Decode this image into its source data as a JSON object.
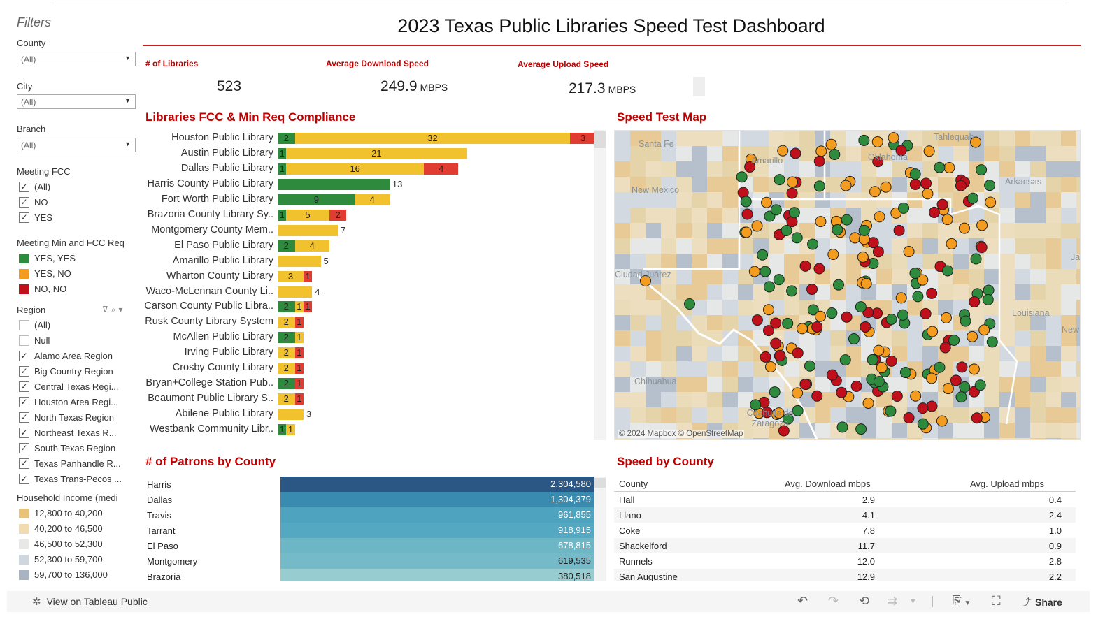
{
  "title": "2023 Texas Public Libraries Speed Test Dashboard",
  "filters": {
    "heading": "Filters",
    "county": {
      "label": "County",
      "value": "(All)"
    },
    "city": {
      "label": "City",
      "value": "(All)"
    },
    "branch": {
      "label": "Branch",
      "value": "(All)"
    },
    "meeting_fcc": {
      "label": "Meeting FCC",
      "options": [
        {
          "label": "(All)",
          "checked": true
        },
        {
          "label": "NO",
          "checked": true
        },
        {
          "label": "YES",
          "checked": true
        }
      ]
    },
    "meeting_min": {
      "label": "Meeting Min and FCC Req",
      "legend": [
        {
          "label": "YES, YES",
          "color": "#2e8b3e"
        },
        {
          "label": "YES, NO",
          "color": "#f39c1f"
        },
        {
          "label": "NO, NO",
          "color": "#c0101c"
        }
      ]
    },
    "region": {
      "label": "Region",
      "options": [
        {
          "label": "(All)",
          "checked": false
        },
        {
          "label": "Null",
          "checked": false
        },
        {
          "label": "Alamo Area Region",
          "checked": true
        },
        {
          "label": "Big Country Region",
          "checked": true
        },
        {
          "label": "Central Texas Regi...",
          "checked": true
        },
        {
          "label": "Houston Area Regi...",
          "checked": true
        },
        {
          "label": "North Texas Region",
          "checked": true
        },
        {
          "label": "Northeast Texas R...",
          "checked": true
        },
        {
          "label": "South Texas Region",
          "checked": true
        },
        {
          "label": "Texas Panhandle R...",
          "checked": true
        },
        {
          "label": "Texas Trans-Pecos ...",
          "checked": true
        }
      ]
    },
    "income": {
      "label": "Household Income (medi",
      "legend": [
        {
          "label": "12,800 to 40,200",
          "color": "#e9c27a"
        },
        {
          "label": "40,200 to 46,500",
          "color": "#f1dcb2"
        },
        {
          "label": "46,500 to 52,300",
          "color": "#e8e8e6"
        },
        {
          "label": "52,300 to 59,700",
          "color": "#cfd6de"
        },
        {
          "label": "59,700 to 136,000",
          "color": "#a8b4c2"
        }
      ]
    }
  },
  "kpis": {
    "libraries_label": "# of Libraries",
    "libraries_value": "523",
    "download_label": "Average Download Speed",
    "download_value": "249.9",
    "download_unit": "MBPS",
    "upload_label": "Average Upload Speed",
    "upload_value": "217.3",
    "upload_unit": "MBPS"
  },
  "compliance": {
    "title": "Libraries FCC & Min Req Compliance",
    "colors": {
      "green": "#2e8b3e",
      "yellow": "#f2c12e",
      "red": "#e03c31"
    },
    "rows": [
      {
        "name": "Houston Public Library",
        "green": 2,
        "yellow": 32,
        "red": 3
      },
      {
        "name": "Austin Public Library",
        "green": 1,
        "yellow": 21,
        "red": 0
      },
      {
        "name": "Dallas Public Library",
        "green": 1,
        "yellow": 16,
        "red": 4
      },
      {
        "name": "Harris County Public Library",
        "green": 13,
        "yellow": 0,
        "red": 0
      },
      {
        "name": "Fort Worth Public Library",
        "green": 9,
        "yellow": 4,
        "red": 0
      },
      {
        "name": "Brazoria County Library Sy..",
        "green": 1,
        "yellow": 5,
        "red": 2
      },
      {
        "name": "Montgomery County Mem..",
        "green": 0,
        "yellow": 7,
        "red": 0
      },
      {
        "name": "El Paso Public Library",
        "green": 2,
        "yellow": 4,
        "red": 0
      },
      {
        "name": "Amarillo Public Library",
        "green": 0,
        "yellow": 5,
        "red": 0
      },
      {
        "name": "Wharton County Library",
        "green": 0,
        "yellow": 3,
        "red": 1
      },
      {
        "name": "Waco-McLennan County Li..",
        "green": 0,
        "yellow": 4,
        "red": 0
      },
      {
        "name": "Carson County Public Libra..",
        "green": 2,
        "yellow": 1,
        "red": 1
      },
      {
        "name": "Rusk County Library System",
        "green": 0,
        "yellow": 2,
        "red": 1
      },
      {
        "name": "McAllen Public Library",
        "green": 2,
        "yellow": 1,
        "red": 0
      },
      {
        "name": "Irving Public Library",
        "green": 0,
        "yellow": 2,
        "red": 1
      },
      {
        "name": "Crosby County Library",
        "green": 0,
        "yellow": 2,
        "red": 1
      },
      {
        "name": "Bryan+College Station Pub..",
        "green": 2,
        "yellow": 0,
        "red": 1
      },
      {
        "name": "Beaumont Public Library S..",
        "green": 0,
        "yellow": 2,
        "red": 1
      },
      {
        "name": "Abilene Public Library",
        "green": 0,
        "yellow": 3,
        "red": 0
      },
      {
        "name": "Westbank Community Libr..",
        "green": 1,
        "yellow": 1,
        "red": 0
      }
    ]
  },
  "map": {
    "title": "Speed Test Map",
    "labels": [
      "Santa Fe",
      "Tahlequah",
      "Oklahoma",
      "Amarillo",
      "Arkansas",
      "New Mexico",
      "Ciudad Juárez",
      "Louisiana",
      "Chihuahua",
      "Coahuila de Zaragoza",
      "Ja",
      "New"
    ],
    "credit": "© 2024 Mapbox  © OpenStreetMap"
  },
  "patrons": {
    "title": "# of Patrons by County",
    "rows": [
      {
        "county": "Harris",
        "value": "2,304,580",
        "color": "#2a5783"
      },
      {
        "county": "Dallas",
        "value": "1,304,379",
        "color": "#3a8bb0"
      },
      {
        "county": "Travis",
        "value": "961,855",
        "color": "#4ea3bf"
      },
      {
        "county": "Tarrant",
        "value": "918,915",
        "color": "#54a8c2"
      },
      {
        "county": "El Paso",
        "value": "678,815",
        "color": "#6db6c6"
      },
      {
        "county": "Montgomery",
        "value": "619,535",
        "color": "#75bac8"
      },
      {
        "county": "Brazoria",
        "value": "380,518",
        "color": "#97ccd0"
      }
    ]
  },
  "speed_table": {
    "title": "Speed by County",
    "headers": [
      "County",
      "Avg. Download mbps",
      "Avg. Upload mbps"
    ],
    "rows": [
      [
        "Hall",
        "2.9",
        "0.4"
      ],
      [
        "Llano",
        "4.1",
        "2.4"
      ],
      [
        "Coke",
        "7.8",
        "1.0"
      ],
      [
        "Shackelford",
        "11.7",
        "0.9"
      ],
      [
        "Runnels",
        "12.0",
        "2.8"
      ],
      [
        "San Augustine",
        "12.9",
        "2.2"
      ]
    ]
  },
  "toolbar": {
    "view_label": "View on Tableau Public",
    "share_label": "Share"
  }
}
